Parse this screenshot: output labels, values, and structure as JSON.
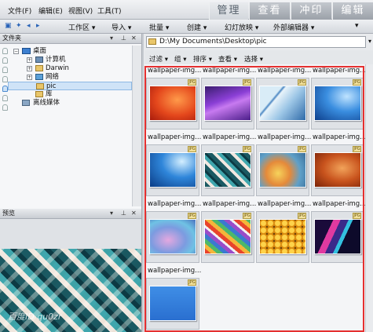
{
  "menubar": {
    "items": [
      "文件(F)",
      "编辑(E)",
      "视图(V)",
      "工具(T)"
    ],
    "modes": [
      "管理",
      "查看",
      "冲印",
      "编辑"
    ],
    "active_mode": "管理"
  },
  "toolbar": {
    "workspace": "工作区",
    "import": "导入",
    "batch": "批量",
    "create": "创建",
    "slideshow": "幻灯放映",
    "external_editor": "外部编辑器"
  },
  "folders_panel": {
    "title": "文件夹",
    "items": [
      {
        "label": "桌面"
      },
      {
        "label": "计算机"
      },
      {
        "label": "Darwin"
      },
      {
        "label": "网络"
      },
      {
        "label": "pic"
      },
      {
        "label": "库"
      },
      {
        "label": "离线媒体"
      }
    ]
  },
  "preview_panel": {
    "title": "预览",
    "watermark": "百度ID qu0zr"
  },
  "path": "D:\\My Documents\\Desktop\\pic",
  "filters": [
    "过滤",
    "组",
    "排序",
    "查看",
    "选择"
  ],
  "thumbnails": {
    "badge": "JPG",
    "items": [
      {
        "label": "wallpaper-img..."
      },
      {
        "label": "wallpaper-img..."
      },
      {
        "label": "wallpaper-img..."
      },
      {
        "label": "wallpaper-img..."
      },
      {
        "label": "wallpaper-img..."
      },
      {
        "label": "wallpaper-img..."
      },
      {
        "label": "wallpaper-img..."
      },
      {
        "label": "wallpaper-img..."
      },
      {
        "label": "wallpaper-img..."
      },
      {
        "label": "wallpaper-img..."
      },
      {
        "label": "wallpaper-img..."
      },
      {
        "label": "wallpaper-img..."
      },
      {
        "label": "wallpaper-img..."
      }
    ]
  },
  "colors": {
    "selection_box": "#e53030",
    "selected_folder_bg": "#cfe3f7"
  }
}
